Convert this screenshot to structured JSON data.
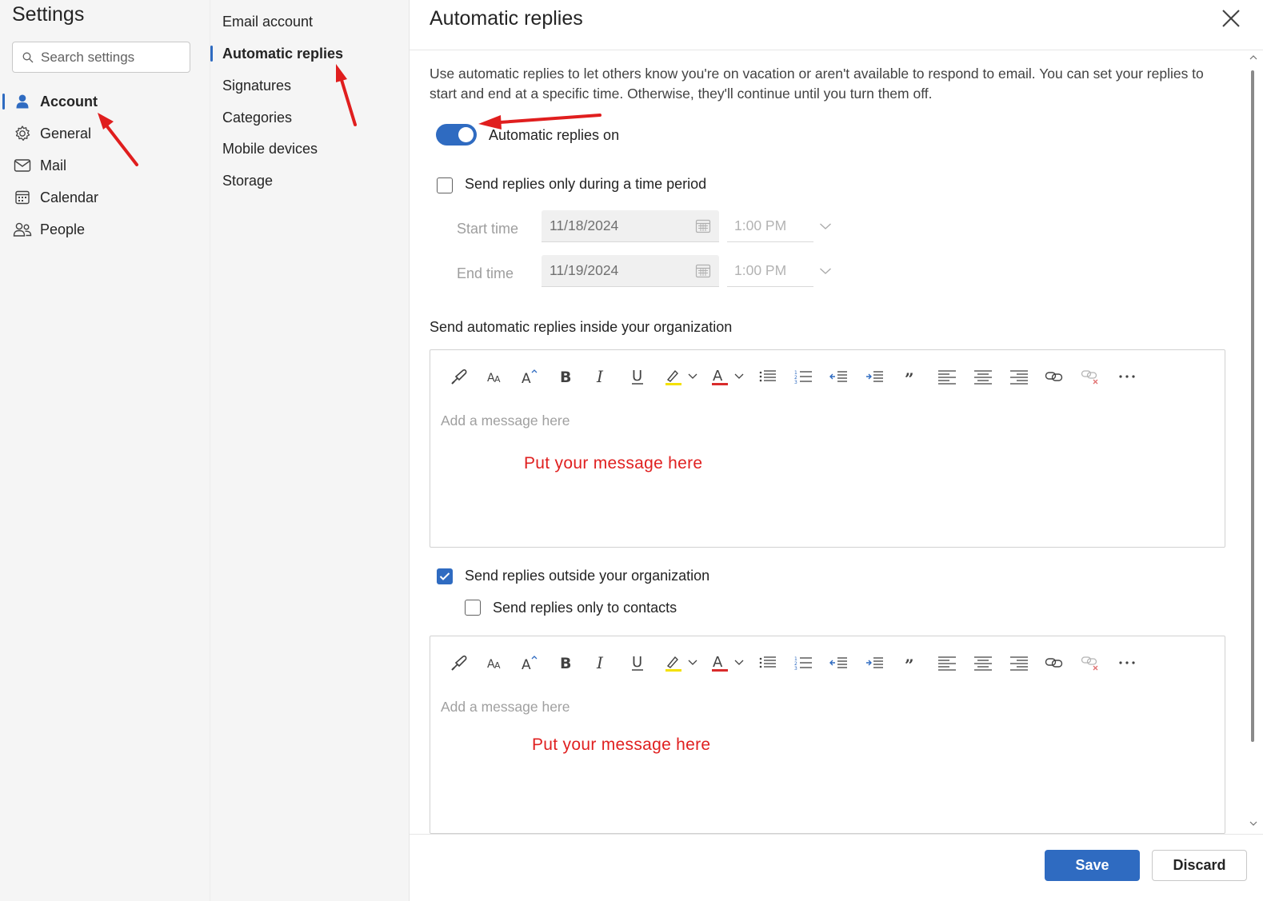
{
  "left_nav": {
    "title": "Settings",
    "search_placeholder": "Search settings",
    "items": [
      {
        "label": "Account",
        "icon": "person-icon"
      },
      {
        "label": "General",
        "icon": "gear-icon"
      },
      {
        "label": "Mail",
        "icon": "mail-icon"
      },
      {
        "label": "Calendar",
        "icon": "calendar-icon"
      },
      {
        "label": "People",
        "icon": "people-icon"
      }
    ],
    "active": "Account"
  },
  "sub_nav": {
    "items": [
      {
        "label": "Email account"
      },
      {
        "label": "Automatic replies"
      },
      {
        "label": "Signatures"
      },
      {
        "label": "Categories"
      },
      {
        "label": "Mobile devices"
      },
      {
        "label": "Storage"
      }
    ],
    "active": "Automatic replies"
  },
  "panel": {
    "title": "Automatic replies",
    "description": "Use automatic replies to let others know you're on vacation or aren't available to respond to email. You can set your replies to start and end at a specific time. Otherwise, they'll continue until you turn them off.",
    "toggle": {
      "label": "Automatic replies on",
      "on": true
    },
    "time_period": {
      "label": "Send replies only during a time period",
      "checked": false,
      "start_label": "Start time",
      "start_date": "11/18/2024",
      "start_time": "1:00 PM",
      "end_label": "End time",
      "end_date": "11/19/2024",
      "end_time": "1:00 PM"
    },
    "inside_label": "Send automatic replies inside your organization",
    "inside_editor": {
      "placeholder": "Add a message here",
      "note": "Put your message here"
    },
    "outside": {
      "label": "Send replies outside your organization",
      "checked": true
    },
    "contacts_only": {
      "label": "Send replies only to contacts",
      "checked": false
    },
    "outside_editor": {
      "placeholder": "Add a message here",
      "note": "Put your message here"
    },
    "save_label": "Save",
    "discard_label": "Discard"
  },
  "colors": {
    "accent": "#2f6bc1",
    "annotation": "#e02020"
  }
}
